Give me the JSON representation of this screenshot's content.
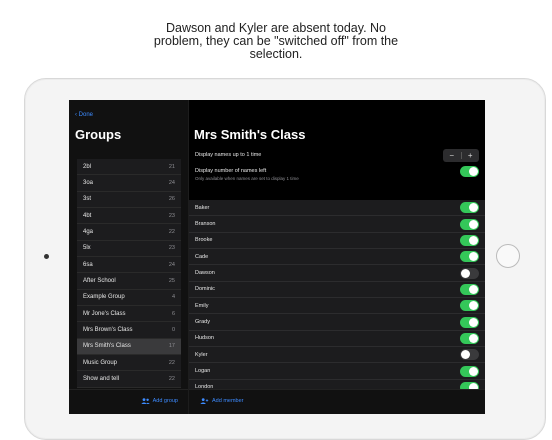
{
  "caption": {
    "line1": "Dawson and Kyler are absent today. No",
    "line2": "problem, they can be \"switched off\" from the",
    "line3": "selection."
  },
  "sidebar": {
    "done_label": "Done",
    "title": "Groups",
    "add_group_label": "Add group",
    "groups": [
      {
        "name": "2bl",
        "count": "21"
      },
      {
        "name": "3oa",
        "count": "24"
      },
      {
        "name": "3st",
        "count": "26"
      },
      {
        "name": "4bt",
        "count": "23"
      },
      {
        "name": "4ga",
        "count": "22"
      },
      {
        "name": "5lx",
        "count": "23"
      },
      {
        "name": "6sa",
        "count": "24"
      },
      {
        "name": "After School",
        "count": "25"
      },
      {
        "name": "Example Group",
        "count": "4"
      },
      {
        "name": "Mr Jone's Class",
        "count": "6"
      },
      {
        "name": "Mrs Brown's Class",
        "count": "0"
      },
      {
        "name": "Mrs Smith's Class",
        "count": "17"
      },
      {
        "name": "Music Group",
        "count": "22"
      },
      {
        "name": "Show and tell",
        "count": "22"
      }
    ]
  },
  "main": {
    "title": "Mrs Smith's Class",
    "display_names_label": "Display names up to 1 time",
    "stepper_minus": "−",
    "stepper_plus": "+",
    "display_left_label": "Display number of names left",
    "display_left_sub": "Only available when names are set to display 1 time",
    "display_left_on": true,
    "add_member_label": "Add member",
    "members": [
      {
        "name": "Baker",
        "on": true
      },
      {
        "name": "Branson",
        "on": true
      },
      {
        "name": "Brooke",
        "on": true
      },
      {
        "name": "Cade",
        "on": true
      },
      {
        "name": "Dawson",
        "on": false
      },
      {
        "name": "Dominic",
        "on": true
      },
      {
        "name": "Emily",
        "on": true
      },
      {
        "name": "Grady",
        "on": true
      },
      {
        "name": "Hudson",
        "on": true
      },
      {
        "name": "Kyler",
        "on": false
      },
      {
        "name": "Logan",
        "on": true
      },
      {
        "name": "London",
        "on": true
      }
    ]
  },
  "colors": {
    "accent": "#3d8bff",
    "toggle_on": "#34c759",
    "toggle_off": "#3a3a3c"
  }
}
